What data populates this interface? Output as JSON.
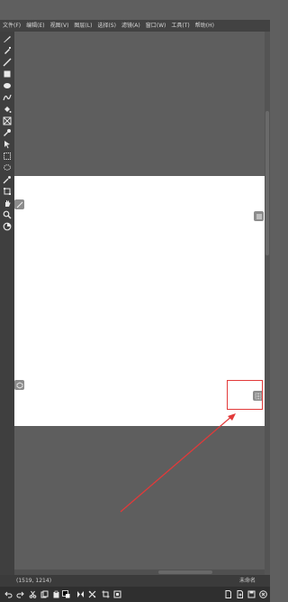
{
  "menubar": {
    "items": [
      "文件(F)",
      "编辑(E)",
      "视图(V)",
      "图层(L)",
      "选择(S)",
      "滤镜(A)",
      "窗口(W)",
      "工具(T)",
      "帮助(H)"
    ]
  },
  "toolbar": {
    "tools": [
      "pen-icon",
      "marker-icon",
      "line-icon",
      "rectangle-icon",
      "ellipse-icon",
      "curve-icon",
      "fill-icon",
      "gradient-icon",
      "eyedropper-icon",
      "select-arrow-icon",
      "rect-select-icon",
      "lasso-icon",
      "magic-wand-icon",
      "transform-icon",
      "hand-icon",
      "zoom-icon",
      "rotate-view-icon"
    ]
  },
  "canvas": {
    "color": "#ffffff",
    "left_panel_button": "brush-settings-icon",
    "right_panel_button": "menu-icon",
    "left_lower_button": "hexagon-icon",
    "right_lower_button": "grid-icon"
  },
  "annotation": {
    "color": "#e23a3a"
  },
  "status": {
    "coordinates": "(1519, 1214)",
    "right_text": "未命名"
  },
  "bottom": {
    "buttons": [
      "undo-icon",
      "redo-icon",
      "cut-icon",
      "copy-icon",
      "paste-icon",
      "color-swap-icon",
      "flip-horizontal-icon",
      "flip-vertical-icon",
      "crop-icon",
      "fit-icon",
      "new-document-icon",
      "open-document-icon",
      "save-icon",
      "close-icon"
    ]
  }
}
